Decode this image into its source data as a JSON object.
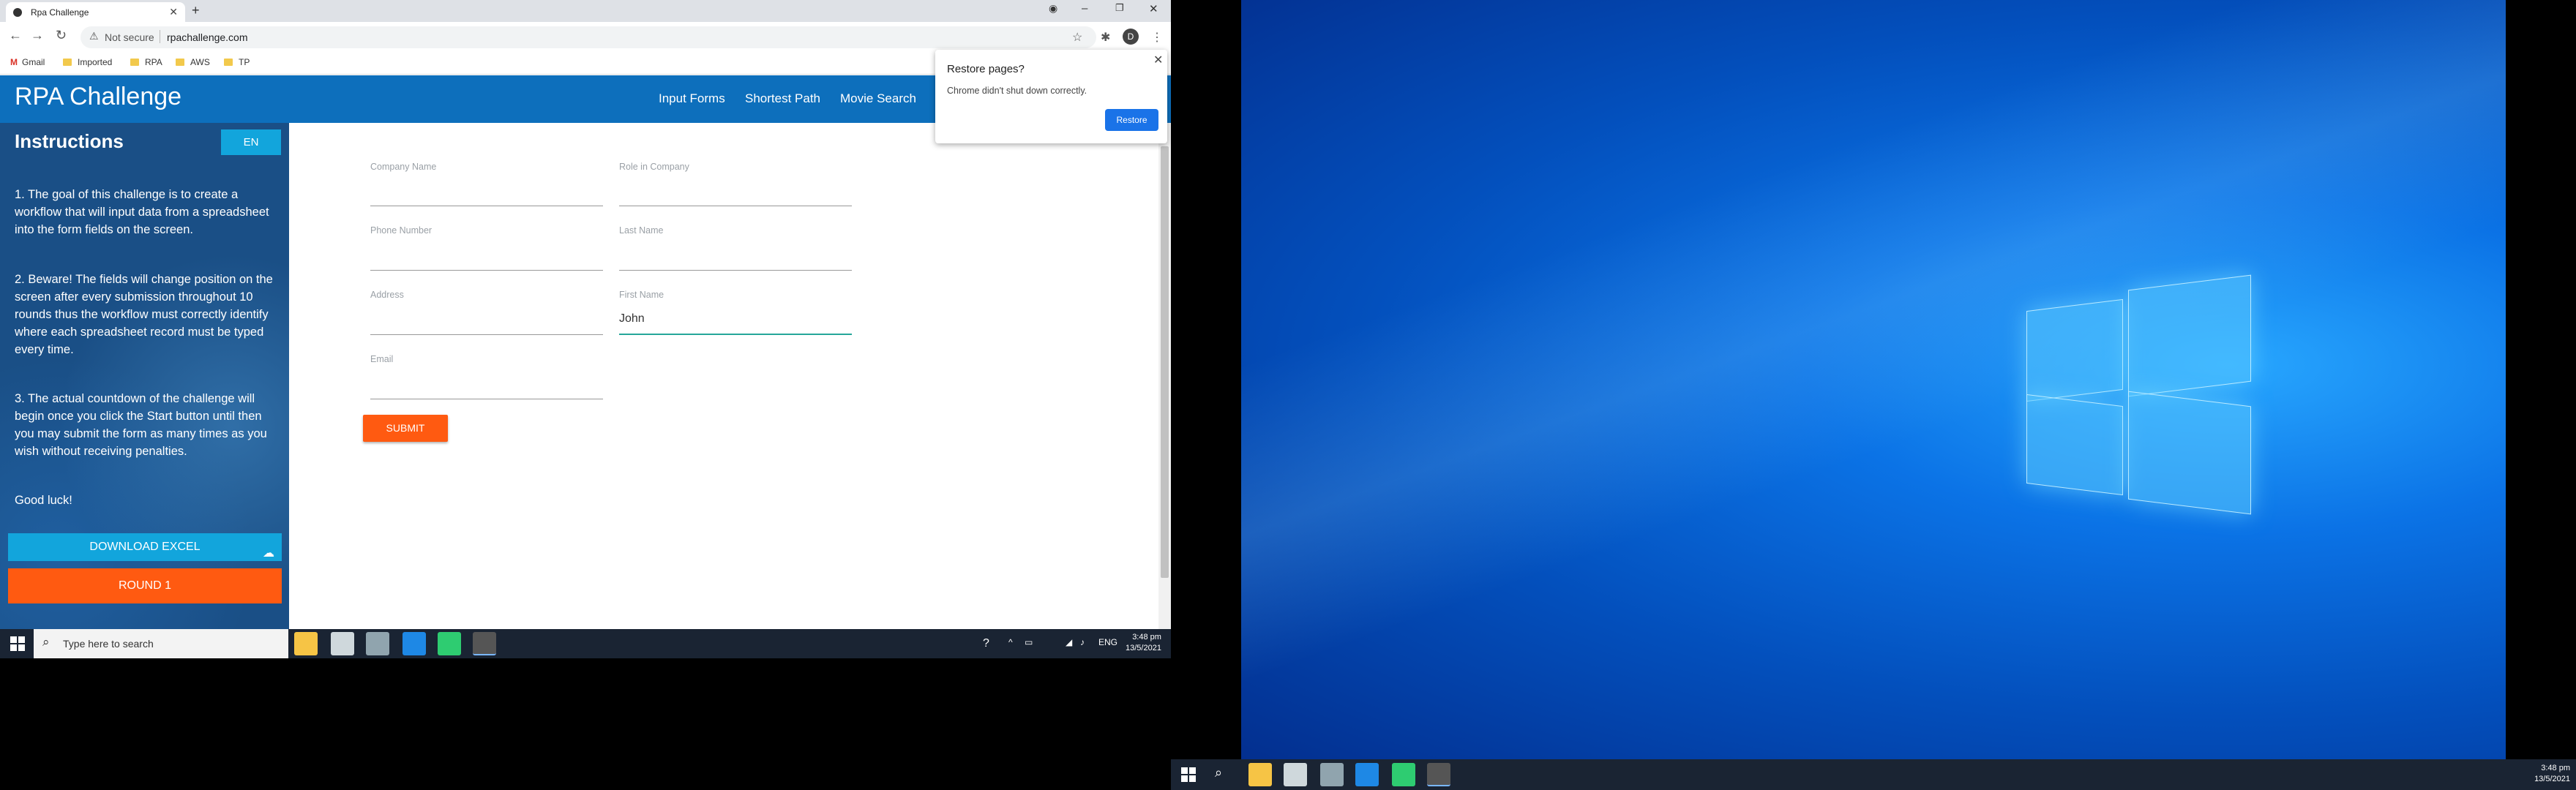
{
  "browser": {
    "tab_title": "Rpa Challenge",
    "address": {
      "security": "Not secure",
      "url": "rpachallenge.com"
    },
    "bookmarks": [
      "Gmail",
      "Imported",
      "RPA",
      "AWS",
      "TP"
    ],
    "profile_initial": "D"
  },
  "site": {
    "brand": "RPA Challenge",
    "nav": [
      "Input Forms",
      "Shortest Path",
      "Movie Search"
    ]
  },
  "sidebar": {
    "title": "Instructions",
    "lang": "EN",
    "paragraphs": [
      "1. The goal of this challenge is to create a workflow that will input data from a spreadsheet into the form fields on the screen.",
      "2. Beware! The fields will change position on the screen after every submission throughout 10 rounds thus the workflow must correctly identify where each spreadsheet record must be typed every time.",
      "3. The actual countdown of the challenge will begin once you click the Start button until then you may submit the form as many times as you wish without receiving penalties.",
      "Good luck!"
    ],
    "download_label": "DOWNLOAD EXCEL",
    "round_label": "ROUND 1"
  },
  "form": {
    "company_name": {
      "label": "Company Name",
      "value": ""
    },
    "role_in_company": {
      "label": "Role in Company",
      "value": ""
    },
    "phone_number": {
      "label": "Phone Number",
      "value": ""
    },
    "last_name": {
      "label": "Last Name",
      "value": ""
    },
    "address": {
      "label": "Address",
      "value": ""
    },
    "first_name": {
      "label": "First Name",
      "value": "John"
    },
    "email": {
      "label": "Email",
      "value": ""
    },
    "submit_label": "SUBMIT"
  },
  "popup": {
    "title": "Restore pages?",
    "message": "Chrome didn't shut down correctly.",
    "button": "Restore"
  },
  "taskbar_left": {
    "search_placeholder": "Type here to search",
    "lang": "ENG",
    "time": "3:48 pm",
    "date": "13/5/2021"
  },
  "taskbar_right": {
    "time": "3:48 pm",
    "date": "13/5/2021"
  },
  "colors": {
    "header_blue": "#0d6fbc",
    "accent_orange": "#ff5a11",
    "accent_cyan": "#12a5dc",
    "active_field": "#26a69a",
    "chrome_button": "#1a73e8"
  }
}
